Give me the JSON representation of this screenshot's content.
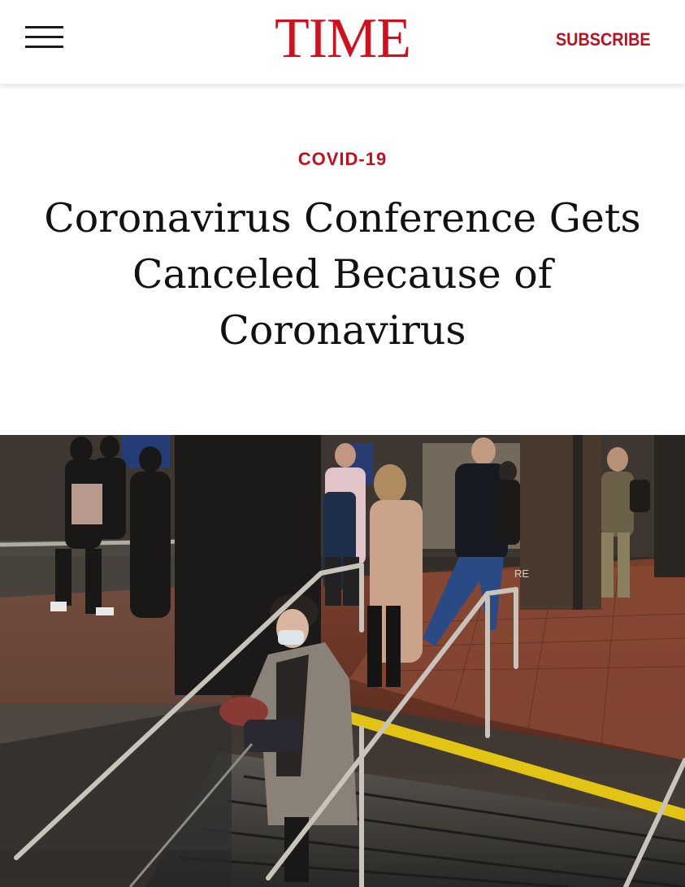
{
  "header": {
    "logo": "TIME",
    "subscribe_label": "SUBSCRIBE",
    "menu_icon": "hamburger-menu-icon",
    "brand_color": "#d0101f"
  },
  "article": {
    "section": "COVID-19",
    "headline": "Coronavirus Conference Gets Canceled Because of Coronavirus",
    "image_sign_text": "RE"
  }
}
